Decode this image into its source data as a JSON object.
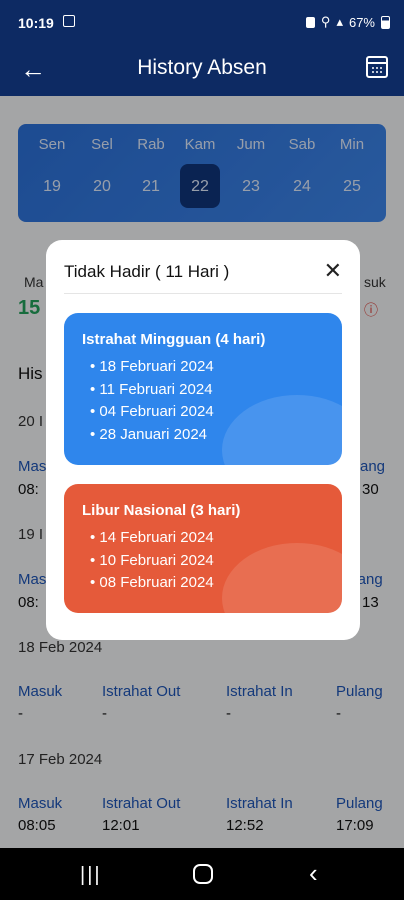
{
  "status_bar": {
    "time": "10:19",
    "battery": "67%"
  },
  "app_bar": {
    "title": "History Absen"
  },
  "week": {
    "days": [
      {
        "name": "Sen",
        "num": "19"
      },
      {
        "name": "Sel",
        "num": "20"
      },
      {
        "name": "Rab",
        "num": "21"
      },
      {
        "name": "Kam",
        "num": "22"
      },
      {
        "name": "Jum",
        "num": "23"
      },
      {
        "name": "Sab",
        "num": "24"
      },
      {
        "name": "Min",
        "num": "25"
      }
    ],
    "selected": "22"
  },
  "summary": {
    "left_label": "Ma",
    "left_value": "15",
    "right_label": "suk"
  },
  "list": {
    "heading": "His",
    "columns": [
      "Masuk",
      "Istrahat Out",
      "Istrahat In",
      "Pulang"
    ],
    "partial_dates": [
      "20 I",
      "19 I"
    ],
    "partial_rows": [
      {
        "first_value": "08:",
        "last_label": "ang",
        "last_value": "30"
      },
      {
        "first_value": "08:",
        "last_value": "13"
      }
    ],
    "rows": [
      {
        "date": "18 Feb 2024",
        "values": [
          "-",
          "-",
          "-",
          "-"
        ]
      },
      {
        "date": "17 Feb 2024",
        "values": [
          "08:05",
          "12:01",
          "12:52",
          "17:09"
        ]
      }
    ]
  },
  "modal": {
    "title": "Tidak Hadir ( 11 Hari )",
    "close_glyph": "✕",
    "cards": [
      {
        "title": "Istrahat Mingguan (4 hari)",
        "color": "#2f86ec",
        "entries": [
          "18 Februari 2024",
          "11 Februari 2024",
          "04 Februari 2024",
          "28 Januari 2024"
        ]
      },
      {
        "title": "Libur Nasional (3 hari)",
        "color": "#e55a3a",
        "entries": [
          "14 Februari 2024",
          "10 Februari 2024",
          "08 Februari 2024"
        ]
      }
    ]
  }
}
